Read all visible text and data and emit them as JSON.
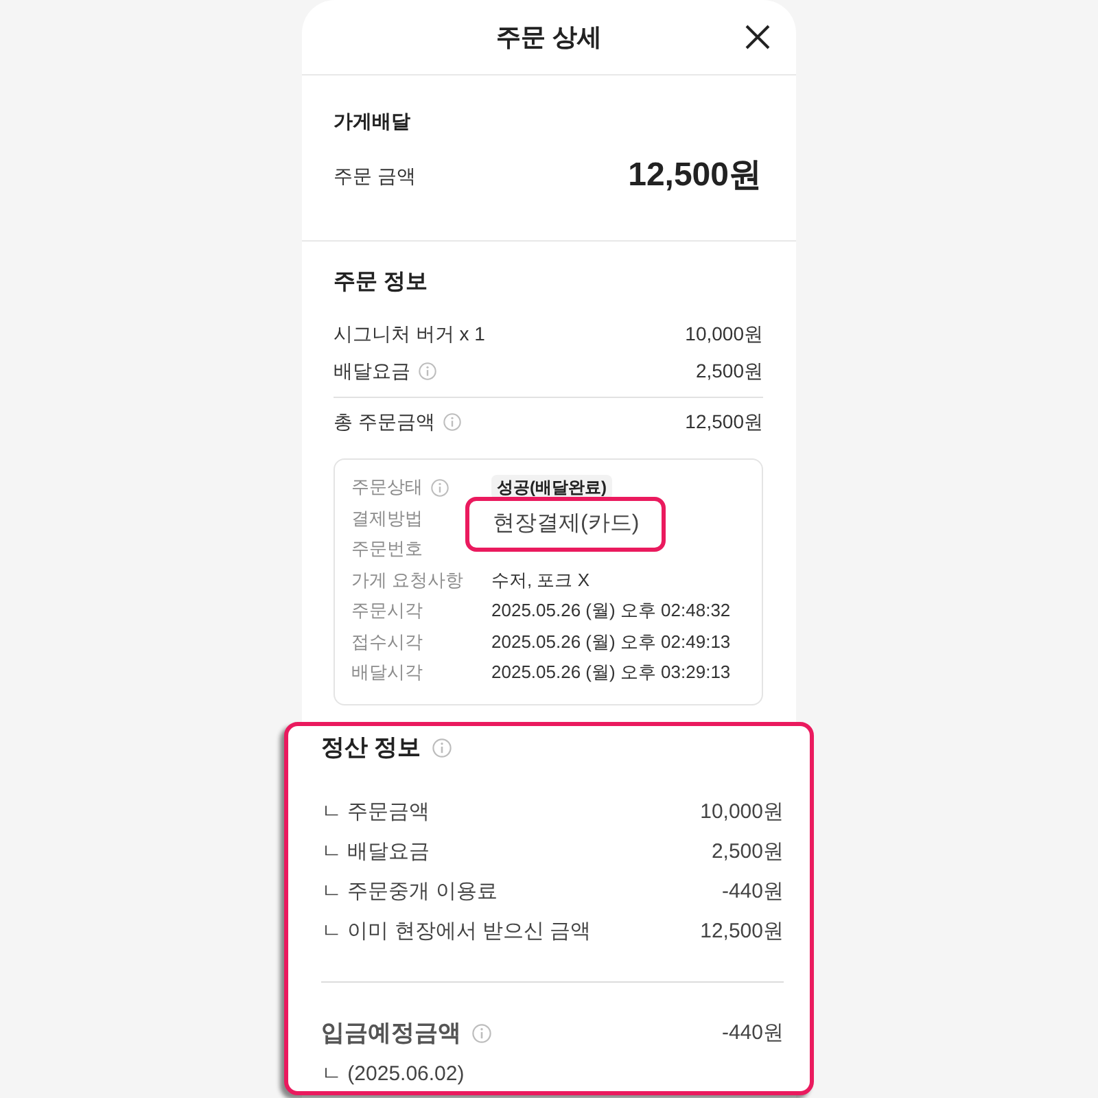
{
  "header": {
    "title": "주문 상세"
  },
  "summary": {
    "type": "가게배달",
    "amount_label": "주문 금액",
    "amount": "12,500원"
  },
  "order_info": {
    "title": "주문 정보",
    "items": [
      {
        "label": "시그니처 버거 x 1",
        "value": "10,000원",
        "info": false
      },
      {
        "label": "배달요금",
        "value": "2,500원",
        "info": true
      }
    ],
    "total": {
      "label": "총 주문금액",
      "value": "12,500원",
      "info": true
    }
  },
  "details": [
    {
      "label": "주문상태",
      "info": true,
      "kind": "badge",
      "value": "성공(배달완료)"
    },
    {
      "label": "결제방법",
      "info": false,
      "kind": "text"
    },
    {
      "label": "주문번호",
      "info": false,
      "kind": "text"
    },
    {
      "label": "가게 요청사항",
      "info": false,
      "kind": "text",
      "value": "수저, 포크 X"
    },
    {
      "label": "주문시각",
      "info": false,
      "kind": "text",
      "value": "2025.05.26 (월) 오후 02:48:32"
    },
    {
      "label": "접수시각",
      "info": false,
      "kind": "text",
      "value": "2025.05.26 (월) 오후 02:49:13"
    },
    {
      "label": "배달시각",
      "info": false,
      "kind": "text",
      "value": "2025.05.26 (월) 오후 03:29:13"
    }
  ],
  "payment_highlight": {
    "value": "현장결제(카드)"
  },
  "settlement": {
    "title": "정산 정보",
    "info": true,
    "items": [
      {
        "label": "ㄴ 주문금액",
        "value": "10,000원"
      },
      {
        "label": "ㄴ 배달요금",
        "value": "2,500원"
      },
      {
        "label": "ㄴ 주문중개 이용료",
        "value": "-440원"
      },
      {
        "label": "ㄴ 이미 현장에서 받으신 금액",
        "value": "12,500원"
      }
    ],
    "deposit": {
      "label": "입금예정금액",
      "info": true,
      "value": "-440원",
      "note": "ㄴ (2025.06.02)"
    }
  }
}
